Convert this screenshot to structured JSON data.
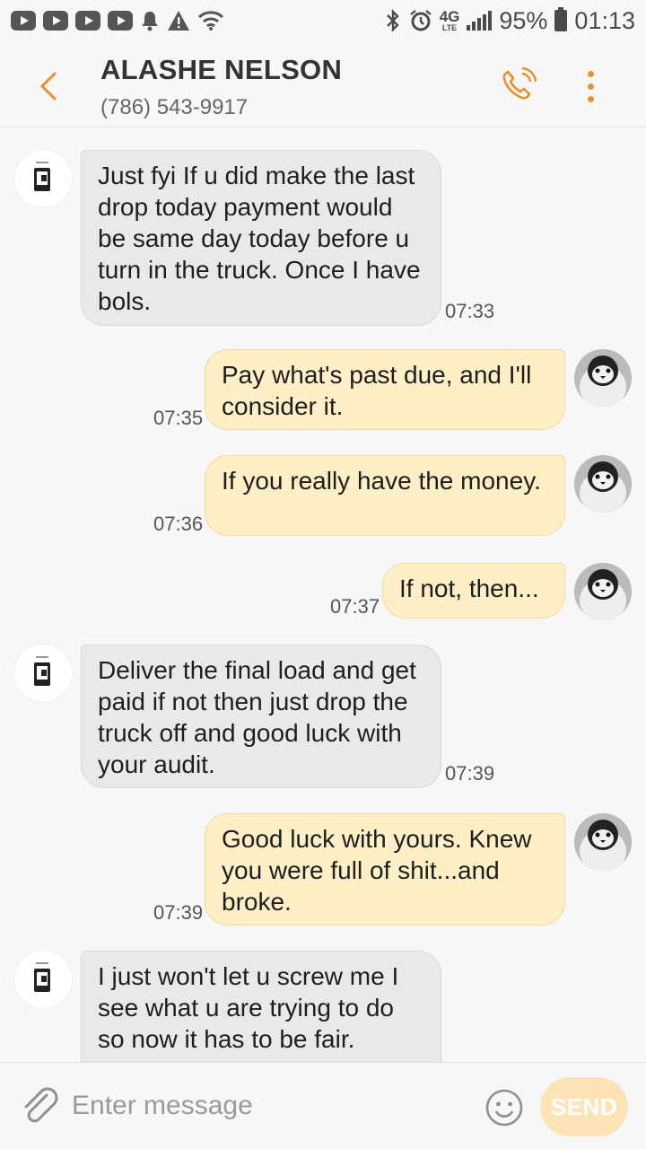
{
  "status_bar": {
    "notification_icons": [
      "youtube-icon",
      "youtube-icon",
      "youtube-icon",
      "youtube-icon",
      "bell-icon",
      "warning-icon",
      "wifi-icon"
    ],
    "system_icons": [
      "bluetooth-icon",
      "alarm-icon",
      "4g-lte-icon",
      "signal-icon"
    ],
    "network": "4G",
    "network_sub": "LTE",
    "battery": "95%",
    "time": "01:13"
  },
  "header": {
    "contact_name": "ALASHE NELSON",
    "contact_phone": "(786) 543-9917"
  },
  "messages": [
    {
      "direction": "in",
      "text": "Just fyi If u did make the last drop today payment would be same day today before u turn in the truck. Once I have bols.",
      "time": "07:33"
    },
    {
      "direction": "out",
      "text": "Pay what's past due, and I'll consider it.",
      "time": "07:35"
    },
    {
      "direction": "out",
      "text": "If you really have the money.",
      "time": "07:36"
    },
    {
      "direction": "out",
      "text": "If not, then...",
      "time": "07:37"
    },
    {
      "direction": "in",
      "text": "Deliver the final load and get paid if not then just drop the truck off and good luck with your audit.",
      "time": "07:39"
    },
    {
      "direction": "out",
      "text": "Good luck with yours. Knew you were full of shit...and broke.",
      "time": "07:39"
    },
    {
      "direction": "in",
      "text": "I just won't let u screw me I see what u are trying to do so now it has to be fair.",
      "time": ""
    }
  ],
  "composer": {
    "placeholder": "Enter message",
    "send_label": "SEND"
  },
  "colors": {
    "accent": "#e3922e",
    "incoming_bubble": "#e9e9e9",
    "outgoing_bubble": "#feefc6",
    "send_button": "#fde4b6"
  }
}
